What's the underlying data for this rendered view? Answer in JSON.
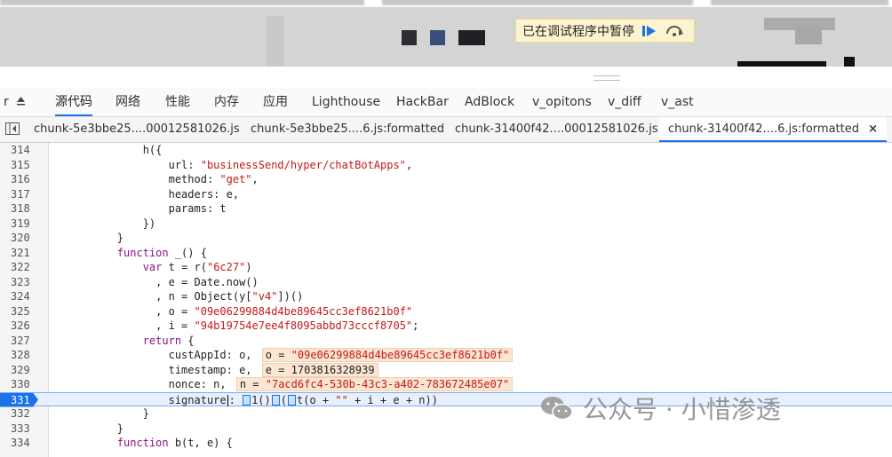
{
  "debugger": {
    "paused_label": "已在调试程序中暂停"
  },
  "tabs": [
    {
      "label": "源代码",
      "active": true
    },
    {
      "label": "网络"
    },
    {
      "label": "性能"
    },
    {
      "label": "内存"
    },
    {
      "label": "应用"
    },
    {
      "label": "Lighthouse"
    },
    {
      "label": "HackBar"
    },
    {
      "label": "AdBlock"
    },
    {
      "label": "v_opitons"
    },
    {
      "label": "v_diff"
    },
    {
      "label": "v_ast"
    }
  ],
  "file_tabs": [
    {
      "label": "chunk-5e3bbe25....00012581026.js"
    },
    {
      "label": "chunk-5e3bbe25....6.js:formatted"
    },
    {
      "label": "chunk-31400f42....00012581026.js"
    },
    {
      "label": "chunk-31400f42....6.js:formatted",
      "active": true,
      "close": "×"
    }
  ],
  "code": {
    "current_line": "331",
    "lines": [
      {
        "n": "314"
      },
      {
        "n": "315"
      },
      {
        "n": "316"
      },
      {
        "n": "317"
      },
      {
        "n": "318"
      },
      {
        "n": "319"
      },
      {
        "n": "320"
      },
      {
        "n": "321"
      },
      {
        "n": "322"
      },
      {
        "n": "323"
      },
      {
        "n": "324"
      },
      {
        "n": "325"
      },
      {
        "n": "326"
      },
      {
        "n": "327"
      },
      {
        "n": "328"
      },
      {
        "n": "329"
      },
      {
        "n": "330"
      },
      {
        "n": "331"
      },
      {
        "n": "332"
      },
      {
        "n": "333"
      },
      {
        "n": "334"
      }
    ],
    "url_value": "\"businessSend/hyper/chatBotApps\"",
    "method_value": "\"get\"",
    "r_arg": "\"6c27\"",
    "y_key": "\"v4\"",
    "o_value": "\"09e06299884d4be89645cc3ef8621b0f\"",
    "i_value": "\"94b19754e7ee4f8095abbd73cccf8705\"",
    "inline_o": "o = ",
    "inline_o_val": "\"09e06299884d4be89645cc3ef8621b0f\"",
    "inline_e": "e = 1703816328939",
    "inline_n": "n = ",
    "inline_n_val": "\"7acd6fc4-530b-43c3-a402-783672485e07\"",
    "empty_str": "\"\""
  },
  "watermark": {
    "text": "公众号 · 小惜渗透"
  },
  "colors": {
    "accent": "#1a73e8",
    "banner_bg": "#fdf4cf",
    "inline_value_bg": "#fbe6d3",
    "string": "#c41a16",
    "keyword": "#881280"
  }
}
